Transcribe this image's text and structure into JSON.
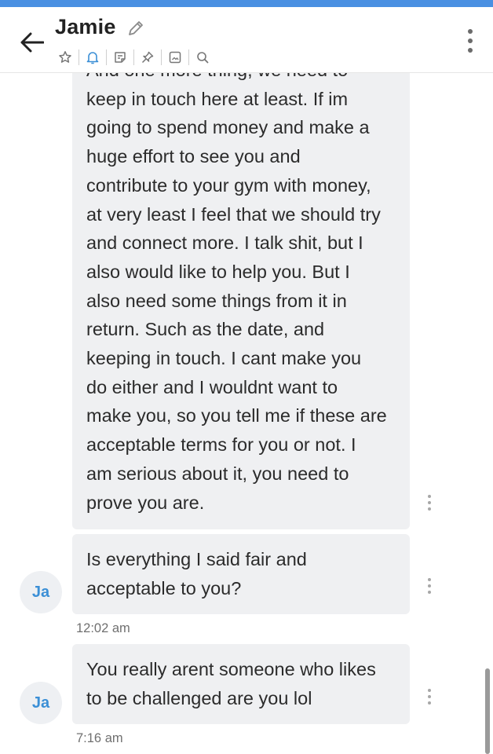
{
  "header": {
    "title": "Jamie",
    "icons": [
      "star-icon",
      "bell-icon",
      "note-icon",
      "pin-icon",
      "image-icon",
      "search-icon"
    ],
    "accent_color": "#4a90e2",
    "active_icon_color": "#3b8fd6"
  },
  "messages": [
    {
      "lines": [
        "And one more thing, we need to",
        "keep in touch here at least. If im",
        "going to spend money and make a",
        "huge effort to see you and",
        "contribute to your gym with money,",
        "at very least I feel that we should try",
        "and connect more. I talk shit, but I",
        "also would like to help you. But I",
        "also need some things from it in",
        "return. Such as the date, and",
        "keeping in touch. I cant make you",
        "do either and I wouldnt want to",
        "make you, so you tell me if these are",
        "acceptable terms for you or not. I",
        "am serious about it, you need to",
        "prove you are."
      ]
    },
    {
      "avatar": "Ja",
      "lines": [
        "Is everything I said fair and",
        "acceptable to you?"
      ],
      "time": "12:02 am"
    },
    {
      "avatar": "Ja",
      "lines": [
        "You really arent someone who likes",
        "to be challenged are you lol"
      ],
      "time": "7:16 am"
    }
  ]
}
